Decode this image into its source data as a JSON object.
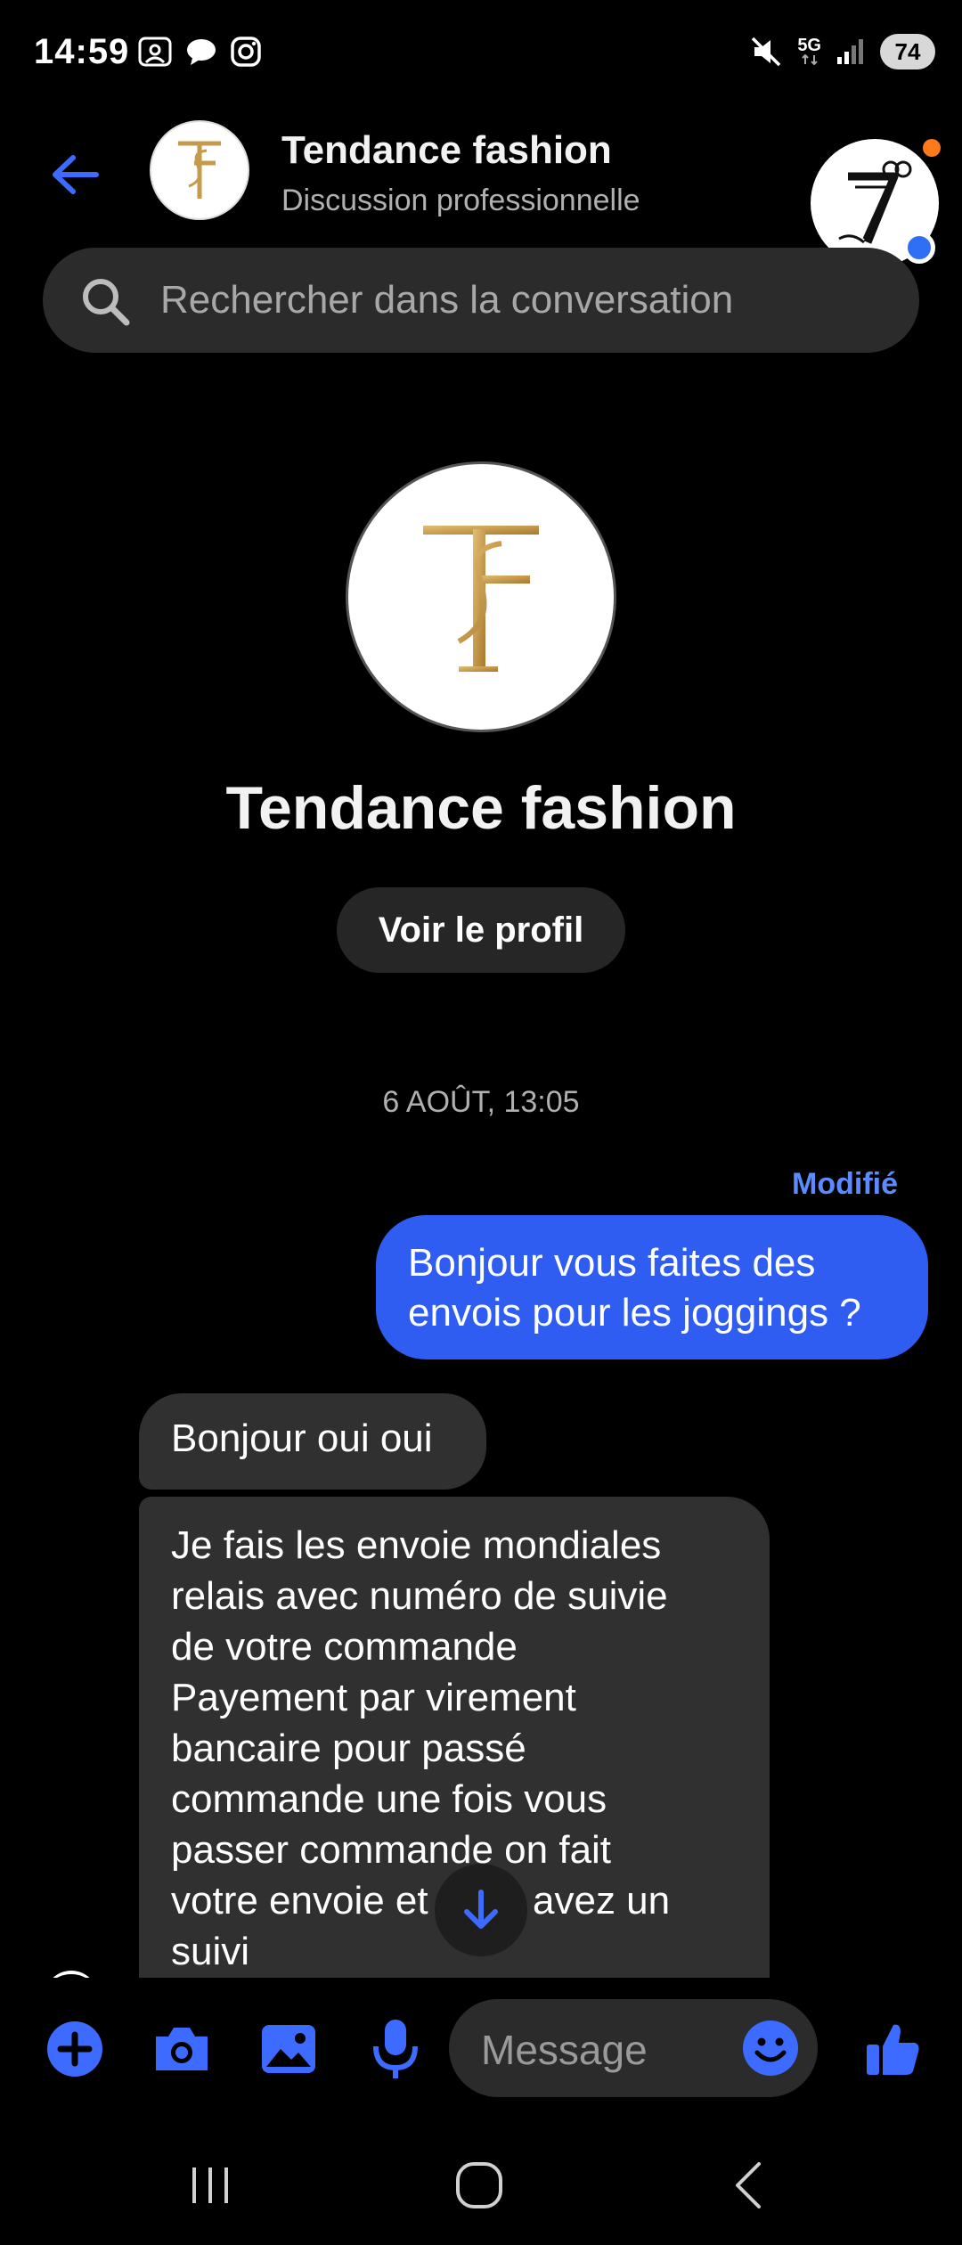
{
  "status_bar": {
    "time": "14:59",
    "network": "5G",
    "battery": "74"
  },
  "header": {
    "title": "Tendance fashion",
    "subtitle": "Discussion professionnelle"
  },
  "search": {
    "placeholder": "Rechercher dans la conversation"
  },
  "intro": {
    "name": "Tendance fashion",
    "view_profile_label": "Voir le profil"
  },
  "conversation": {
    "date": "6 AOÛT, 13:05",
    "edited_label": "Modifié",
    "messages": [
      {
        "direction": "sent",
        "text": "Bonjour vous faites des envois pour les joggings ?"
      },
      {
        "direction": "received",
        "text": "Bonjour oui oui"
      },
      {
        "direction": "received",
        "text": "Je fais les envoie mondiales\nrelais avec numéro de suivie\nde votre commande\nPayement par virement\nbancaire pour passé\ncommande une fois vous\npasser commande on fait\nvotre envoie et vous avez un\nsuivi"
      }
    ]
  },
  "composer": {
    "placeholder": "Message"
  },
  "colors": {
    "accent": "#2f5cf1",
    "icon_blue": "#3d6bff",
    "background": "#000000",
    "bubble_received": "#303030",
    "logo_gold": "#c59a4a"
  },
  "icons": {
    "back": "back-arrow-icon",
    "search": "search-icon",
    "plus": "plus-icon",
    "camera": "camera-icon",
    "gallery": "image-icon",
    "mic": "microphone-icon",
    "emoji": "emoji-icon",
    "like": "thumbs-up-icon",
    "scroll_down": "arrow-down-icon"
  }
}
